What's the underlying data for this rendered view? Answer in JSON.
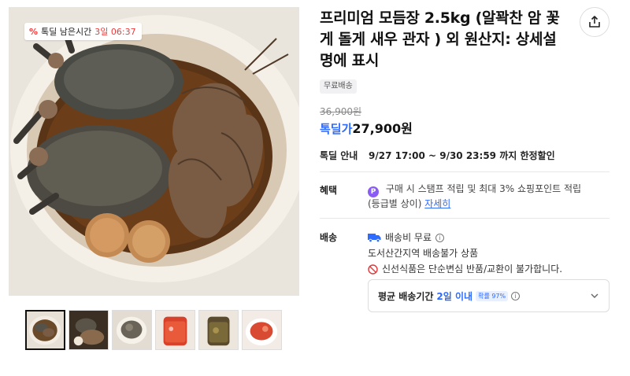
{
  "image": {
    "timer_badge": {
      "icon": "percent-tag-icon",
      "icon_text": "%",
      "label": "톡딜 남은시간",
      "time": "3일 06:37"
    },
    "thumbnails": [
      "thumb-crab-plate",
      "thumb-crab-jar",
      "thumb-crab-bowl",
      "thumb-kimchi-jar",
      "thumb-pickle-jar",
      "thumb-kimchi-bowl"
    ]
  },
  "product": {
    "title": "프리미엄 모듬장 2.5kg (알꽉찬 암 꽃게 돌게 새우 관자 ) 외 원산지: 상세설명에 표시",
    "free_shipping_tag": "무료배송",
    "original_price": "36,900원",
    "price_label": "톡딜가",
    "price": "27,900원"
  },
  "sale": {
    "label": "톡딜 안내",
    "period": "9/27 17:00 ~ 9/30 23:59 까지 한정할인"
  },
  "benefit": {
    "label": "혜택",
    "icon_text": "P",
    "text": "구매 시 스탬프 적립 및 최대 3% 쇼핑포인트 적립",
    "text2": "(등급별 상이)",
    "link": "자세히"
  },
  "shipping": {
    "label": "배송",
    "fee": "배송비 무료",
    "info_glyph": "i",
    "restriction": "도서산간지역 배송불가 상품",
    "notice": "신선식품은 단순변심 반품/교환이 불가합니다.",
    "avg_label": "평균 배송기간",
    "avg_value": "2일 이내",
    "prob_badge": "확률 97%"
  },
  "colors": {
    "accent": "#2e6bff",
    "sale_red": "#ef3b3b",
    "point_purple": "#8a5cf5"
  }
}
